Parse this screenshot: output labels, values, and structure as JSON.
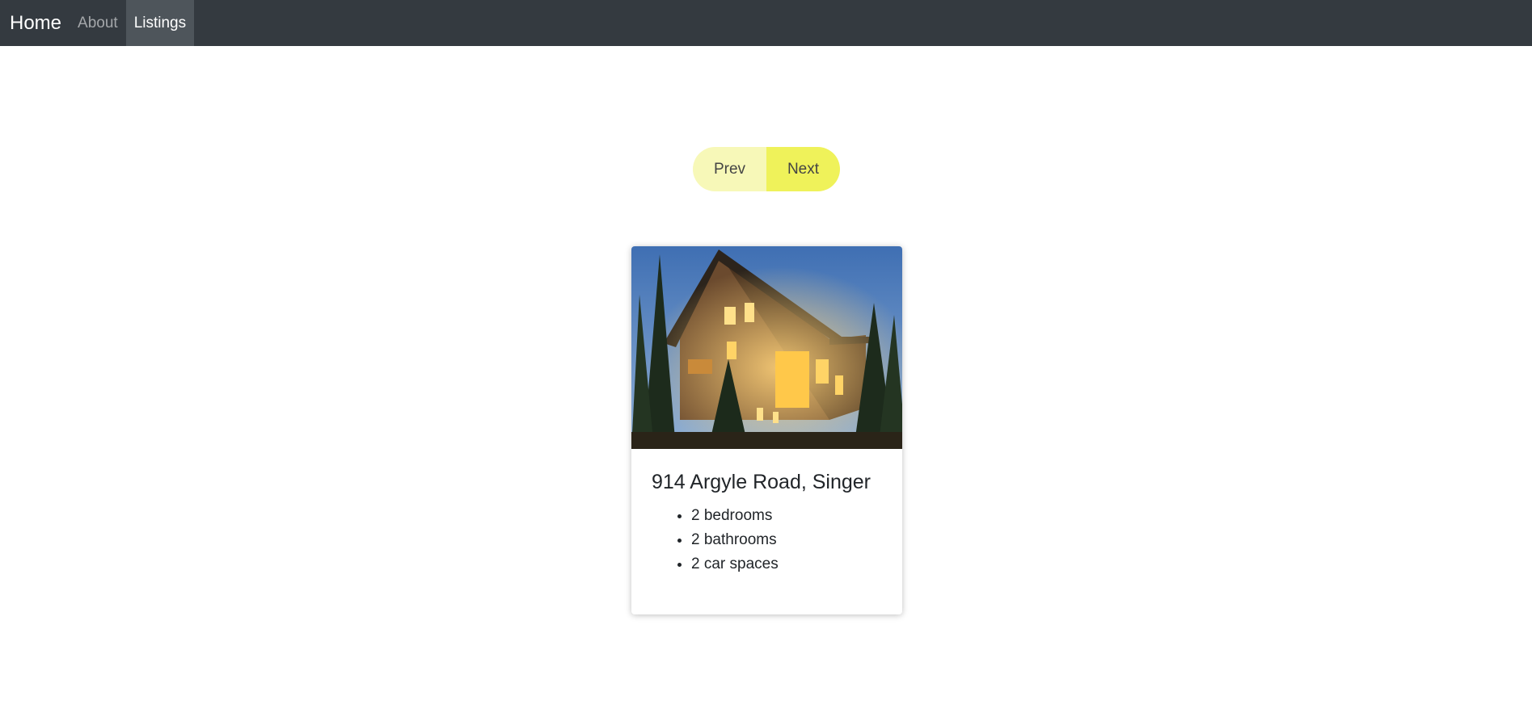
{
  "nav": {
    "brand": "Home",
    "links": [
      {
        "label": "About",
        "active": false
      },
      {
        "label": "Listings",
        "active": true
      }
    ]
  },
  "pager": {
    "prev_label": "Prev",
    "next_label": "Next"
  },
  "listing": {
    "address": "914 Argyle Road, Singer",
    "features": [
      "2 bedrooms",
      "2 bathrooms",
      "2 car spaces"
    ]
  },
  "colors": {
    "navbar_bg": "#343a40",
    "prev_bg": "#f7f8b8",
    "next_bg": "#eff25a"
  }
}
